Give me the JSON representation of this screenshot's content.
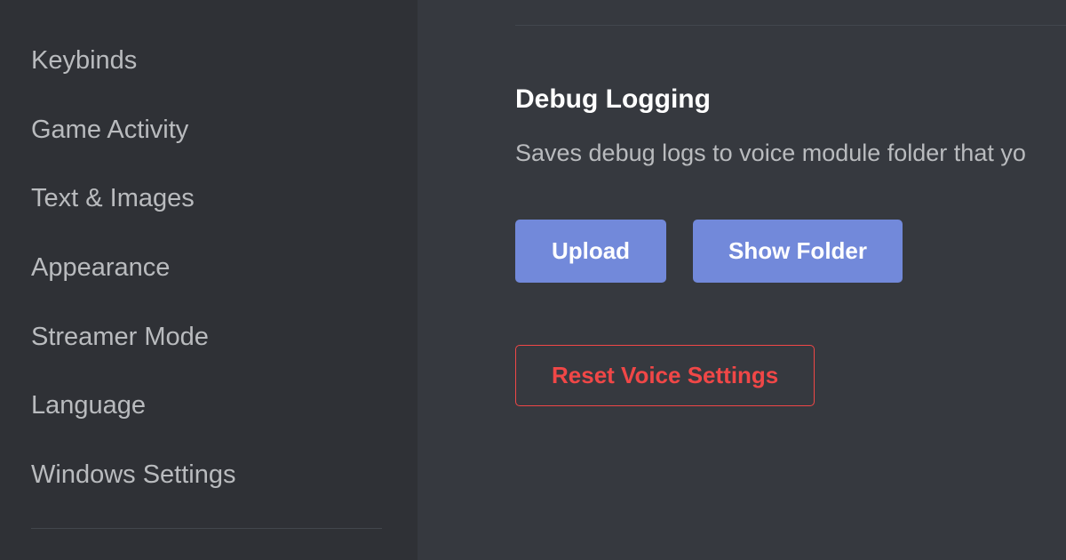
{
  "sidebar": {
    "items": [
      {
        "label": "Keybinds"
      },
      {
        "label": "Game Activity"
      },
      {
        "label": "Text & Images"
      },
      {
        "label": "Appearance"
      },
      {
        "label": "Streamer Mode"
      },
      {
        "label": "Language"
      },
      {
        "label": "Windows Settings"
      }
    ]
  },
  "content": {
    "debug_logging": {
      "title": "Debug Logging",
      "description": "Saves debug logs to voice module folder that yo",
      "upload_label": "Upload",
      "show_folder_label": "Show Folder"
    },
    "reset_label": "Reset Voice Settings"
  },
  "colors": {
    "sidebar_bg": "#2f3136",
    "content_bg": "#36393f",
    "text_muted": "#b9bbbe",
    "text_white": "#ffffff",
    "primary": "#7289da",
    "danger": "#f04747"
  }
}
